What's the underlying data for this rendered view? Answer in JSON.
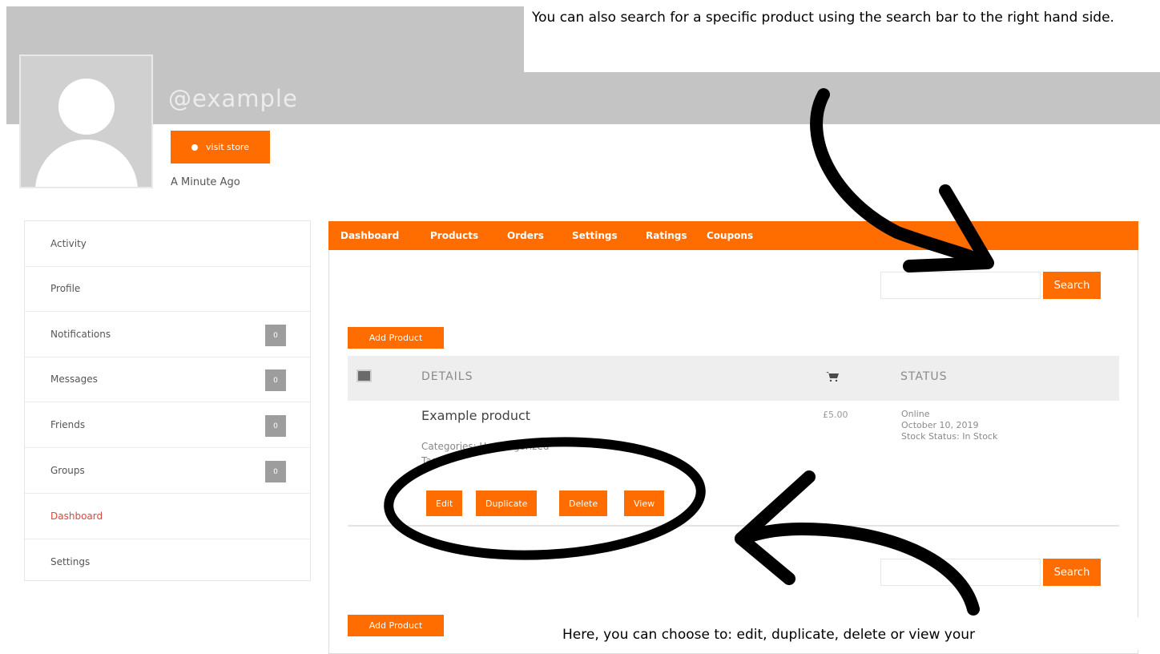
{
  "header": {
    "username": "@example",
    "visit_store_label": "visit store",
    "last_active": "A Minute Ago"
  },
  "sidebar": {
    "items": [
      {
        "label": "Activity"
      },
      {
        "label": "Profile"
      },
      {
        "label": "Notifications",
        "badge": "0"
      },
      {
        "label": "Messages",
        "badge": "0"
      },
      {
        "label": "Friends",
        "badge": "0"
      },
      {
        "label": "Groups",
        "badge": "0"
      },
      {
        "label": "Dashboard",
        "active": true
      },
      {
        "label": "Settings"
      }
    ]
  },
  "dashboard": {
    "tabs": [
      "Dashboard",
      "Products",
      "Orders",
      "Settings",
      "Ratings",
      "Coupons"
    ],
    "search_label": "Search",
    "add_product_label": "Add Product",
    "table_headers": {
      "details": "DETAILS",
      "status": "STATUS"
    },
    "product": {
      "name": "Example product",
      "categories": "Categories: Uncategorized",
      "tags": "Tags:",
      "price": "£5.00",
      "status": "Online",
      "date": "October 10, 2019",
      "stock": "Stock Status: In Stock"
    },
    "row_actions": [
      "Edit",
      "Duplicate",
      "Delete",
      "View"
    ]
  },
  "annotations": {
    "top_text": "You can also search for a specific product using the search bar to the right hand side.",
    "bottom_text": "Here, you can choose to: edit, duplicate, delete or view your"
  },
  "colors": {
    "accent": "#ff6c00",
    "header_bg": "#c4c4c4",
    "active_link": "#e0443a"
  },
  "icons": [
    "user-avatar-icon",
    "eye-icon",
    "image-icon",
    "cart-icon"
  ]
}
